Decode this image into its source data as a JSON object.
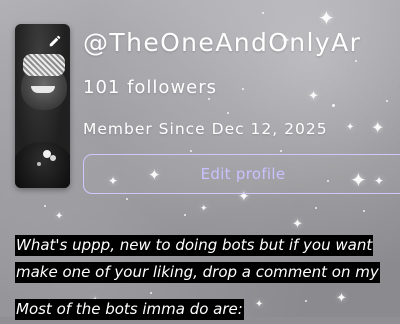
{
  "profile": {
    "username": "@TheOneAndOnlyAr",
    "followers": "101 followers",
    "member_since": "Member Since Dec 12, 2025",
    "edit_profile_label": "Edit profile",
    "avatar_edit_icon": "pencil-icon"
  },
  "bio": {
    "line1": "What's uppp, new to doing bots but if you want",
    "line2": "make one of your liking, drop a comment on my",
    "line3": "Most of the bots imma do are:"
  },
  "colors": {
    "accent": "#c9c1ff",
    "background": "#9a9a9f",
    "highlight": "#000000"
  }
}
